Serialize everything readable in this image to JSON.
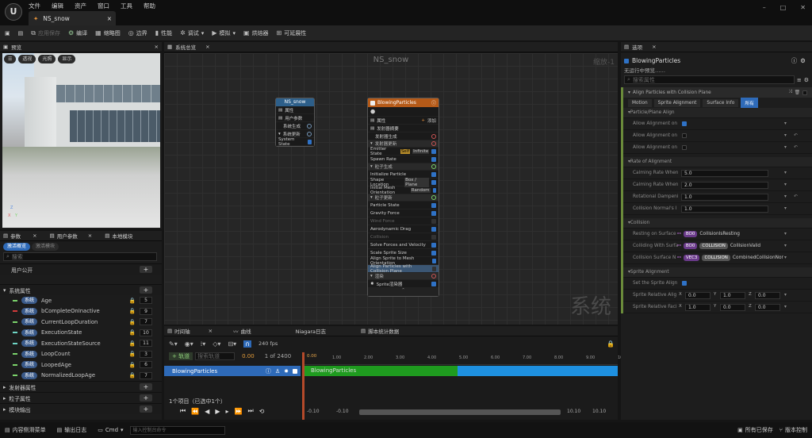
{
  "app": {
    "doc_tab": "NS_snow",
    "menu": [
      "文件",
      "编辑",
      "资产",
      "窗口",
      "工具",
      "帮助"
    ]
  },
  "toolbar": {
    "apply_save": "应用保存",
    "compile": "编译",
    "thumbnail": "缩略图",
    "bounds": "边界",
    "performance": "性能",
    "debug": "调试",
    "simulate": "模拟",
    "baker": "烘焙器",
    "scalability": "可延展性"
  },
  "preview": {
    "tab": "预览",
    "perspective": "透视",
    "lit": "光照",
    "show": "显示"
  },
  "params": {
    "tab_params": "参数",
    "tab_user": "用户参数",
    "tab_local": "本地模块",
    "filter_active": "激活概览",
    "filter_inactive": "激活模块",
    "search_placeholder": "搜索",
    "user_public": "用户公开",
    "system_attrs": "系统属性",
    "items": [
      {
        "tag": "系统",
        "name": "Age",
        "value": "5",
        "color": "#7bd36b"
      },
      {
        "tag": "系统",
        "name": "bCompleteOnInactive",
        "value": "9",
        "color": "#d33b3b"
      },
      {
        "tag": "系统",
        "name": "CurrentLoopDuration",
        "value": "7",
        "color": "#7bd36b"
      },
      {
        "tag": "系统",
        "name": "ExecutionState",
        "value": "10",
        "color": "#6fd6c6"
      },
      {
        "tag": "系统",
        "name": "ExecutionStateSource",
        "value": "11",
        "color": "#6fd6c6"
      },
      {
        "tag": "系统",
        "name": "LoopCount",
        "value": "3",
        "color": "#7bd36b"
      },
      {
        "tag": "系统",
        "name": "LoopedAge",
        "value": "6",
        "color": "#7bd36b"
      },
      {
        "tag": "系统",
        "name": "NormalizedLoopAge",
        "value": "7",
        "color": "#7bd36b"
      }
    ],
    "emitter_attrs": "发射器属性",
    "particle_attrs": "粒子属性",
    "module_output": "模块输出"
  },
  "graph": {
    "tab": "系统总览",
    "title": "NS_snow",
    "zoom": "缩放-1",
    "watermark": "系统",
    "system_node": {
      "title": "NS_snow",
      "rows": [
        "属性",
        "用户参数",
        "系统生成",
        "系统更新",
        "System State"
      ]
    },
    "emitter_node": {
      "title": "BlowingParticles",
      "props": "属性",
      "add": "添加",
      "summary": "发射器摘要",
      "emitter_spawn": "发射器生成",
      "emitter_update": "发射器更新",
      "emitter_state": "Emitter State",
      "self": "Self",
      "infinite": "Infinite",
      "spawn_rate": "Spawn Rate",
      "particle_spawn": "粒子生成",
      "initialize": "Initialize Particle",
      "shape_location": "Shape Location",
      "box_plane": "Box / Plane",
      "mesh_orient": "Initial Mesh Orientation",
      "random": "Random",
      "particle_update": "粒子更新",
      "particle_state": "Particle State",
      "gravity": "Gravity Force",
      "wind": "Wind Force",
      "aero": "Aerodynamic Drag",
      "collision": "Collision",
      "solve": "Solve Forces and Velocity",
      "scale_sprite": "Scale Sprite Size",
      "align_mesh": "Align Sprite to Mesh Orientation",
      "align_collision": "Align Particles with Collision Plane",
      "render": "渲染",
      "sprite_renderer": "Sprite渲染器"
    }
  },
  "timeline": {
    "tabs": [
      "时间轴",
      "曲线",
      "Niagara日志",
      "脚本统计数据"
    ],
    "fps": "240 fps",
    "add_track": "+ 轨道",
    "search_placeholder": "搜索轨道",
    "track": "BlowingParticles",
    "time_start": "0.00",
    "frame": "1 of 2400",
    "ticks": [
      "1.00",
      "2.00",
      "3.00",
      "4.00",
      "5.00",
      "6.00",
      "7.00",
      "8.00",
      "9.00",
      "10.00"
    ],
    "cursor": "0.00",
    "bar_label": "BlowingParticles",
    "selection": "1个项目（已选中1个）",
    "lower_left1": "-0.10",
    "lower_left2": "-0.10",
    "lower_right1": "10.10",
    "lower_right2": "10.10"
  },
  "details": {
    "tab": "选项",
    "name": "BlowingParticles",
    "sub": "无运行中预览……",
    "search_placeholder": "搜索属性",
    "module": "Align Particles with Collision Plane",
    "tabs": [
      "Motion",
      "Sprite Alignment",
      "Surface Info",
      "所有"
    ],
    "sections": {
      "plane_align": "Particle/Plane Align",
      "rate": "Rate of Alignment",
      "collision": "Collision",
      "sprite_align": "Sprite Alignment"
    },
    "plane_rows": [
      "Allow Alignment on",
      "Allow Alignment on",
      "Allow Alignment on"
    ],
    "rate_rows": [
      {
        "label": "Calming Rate When",
        "value": "5.0"
      },
      {
        "label": "Calming Rate When",
        "value": "2.0"
      },
      {
        "label": "Rotational Dampeni",
        "value": "1.0"
      },
      {
        "label": "Collision Normal's I",
        "value": "1.0"
      }
    ],
    "collision_rows": [
      {
        "label": "Resting on Surface",
        "t1": "BO0",
        "t2": "",
        "val": "CollisionIsResting"
      },
      {
        "label": "Colliding With Surfa",
        "t1": "BO0",
        "t2": "COLLISION",
        "val": "CollisionValid"
      },
      {
        "label": "Collision Surface N",
        "t1": "VEC3",
        "t2": "COLLISION",
        "val": "CombinedCollisionNor"
      }
    ],
    "sprite_rows": [
      {
        "label": "Set the Sprite Align"
      },
      {
        "label": "Sprite Relative Alig",
        "x": "0.0",
        "y": "1.0",
        "z": "0.0"
      },
      {
        "label": "Sprite Relative Faci",
        "x": "1.0",
        "y": "0.0",
        "z": "0.0"
      }
    ]
  },
  "statusbar": {
    "content": "内容侧滑菜单",
    "output": "输出日志",
    "cmd": "Cmd",
    "cmd_placeholder": "输入控制台命令",
    "saved": "所有已保存",
    "vcs": "版本控制"
  }
}
